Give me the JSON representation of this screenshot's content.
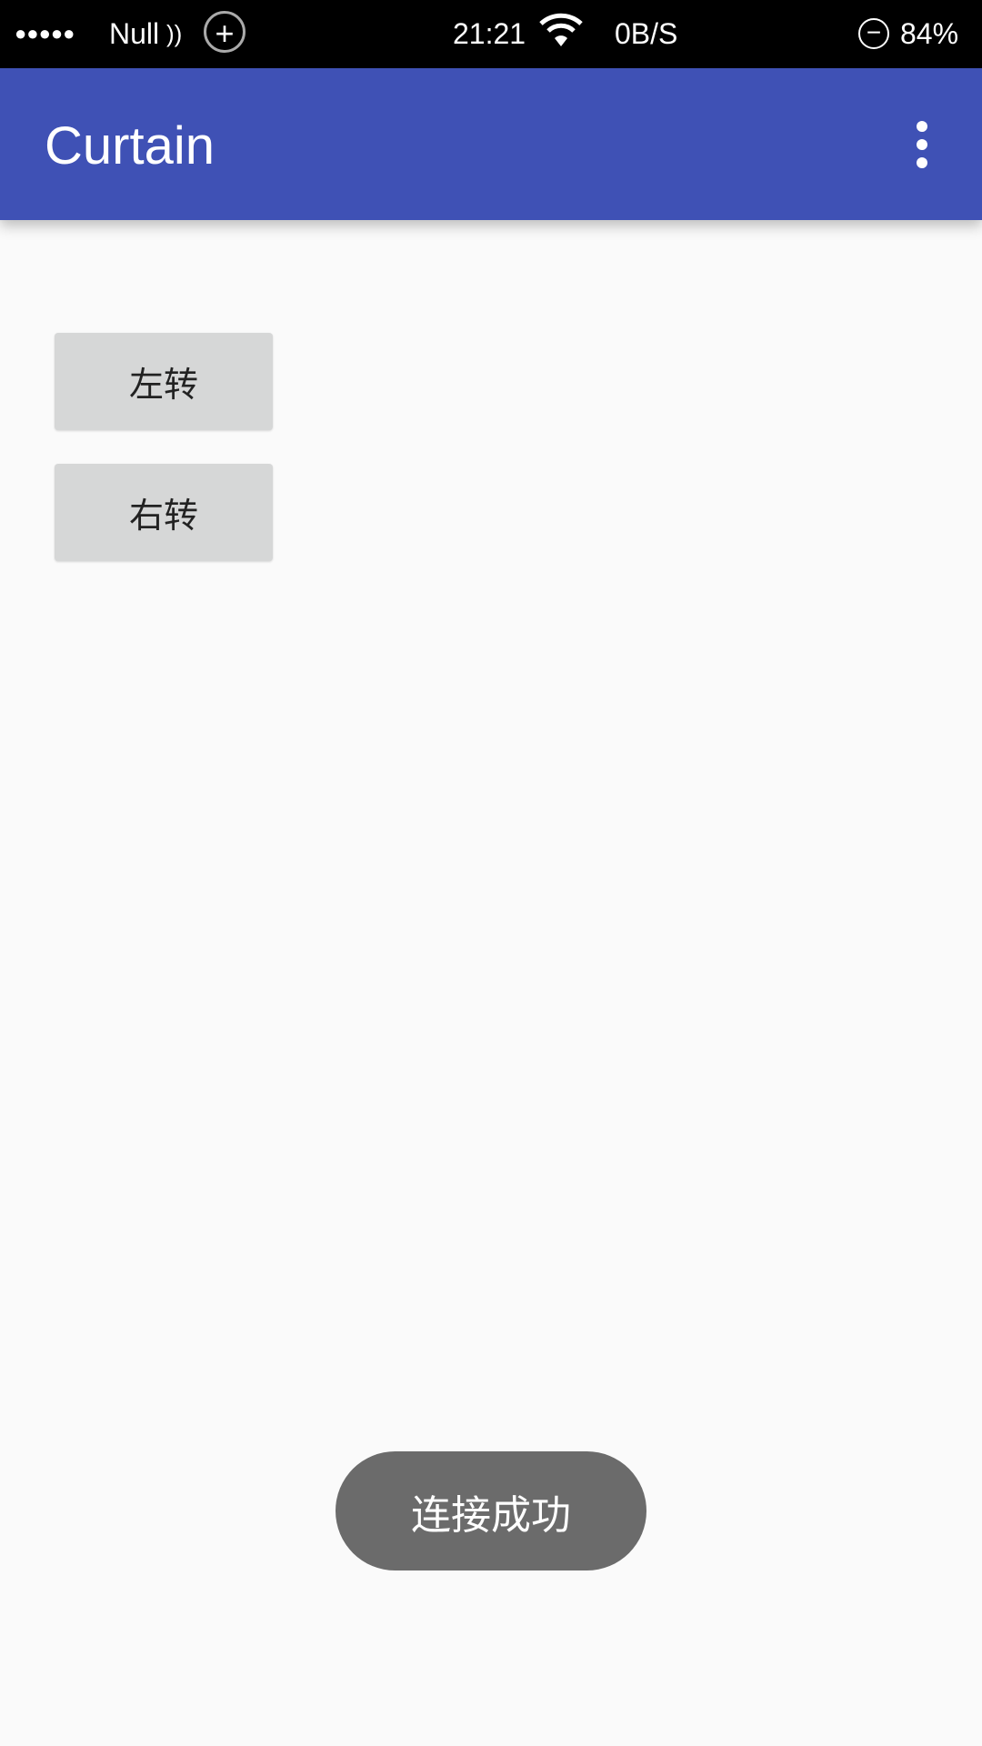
{
  "status_bar": {
    "signal": "●●●●●",
    "carrier": "Null",
    "time": "21:21",
    "net_speed": "0B/S",
    "battery": "84%"
  },
  "app_bar": {
    "title": "Curtain"
  },
  "buttons": {
    "left": "左转",
    "right": "右转"
  },
  "toast": "连接成功"
}
